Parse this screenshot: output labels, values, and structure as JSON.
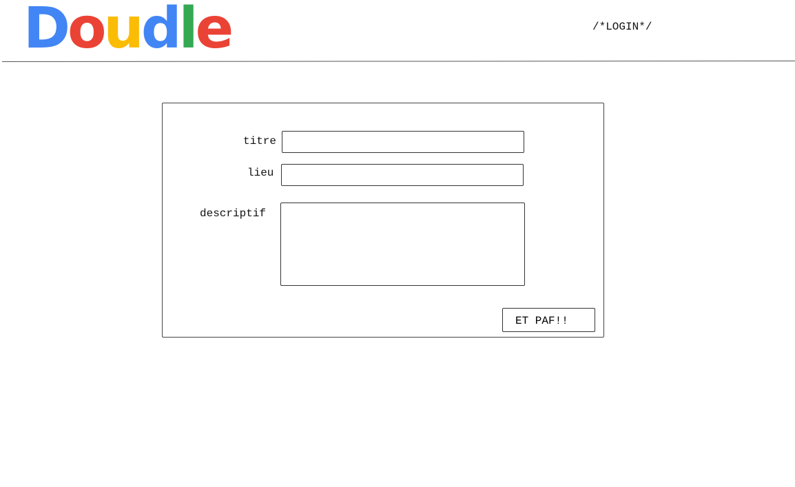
{
  "header": {
    "logo": {
      "letters": [
        {
          "char": "D",
          "color": "#4285F4"
        },
        {
          "char": "o",
          "color": "#EA4335"
        },
        {
          "char": "u",
          "color": "#FBBC05"
        },
        {
          "char": "d",
          "color": "#4285F4"
        },
        {
          "char": "l",
          "color": "#34A853"
        },
        {
          "char": "e",
          "color": "#EA4335"
        }
      ]
    },
    "login_label": "/*LOGIN*/"
  },
  "form": {
    "title_label": "titre",
    "location_label": "lieu",
    "description_label": "descriptif",
    "title_value": "",
    "location_value": "",
    "description_value": "",
    "submit_label": "ET PAF!!"
  }
}
